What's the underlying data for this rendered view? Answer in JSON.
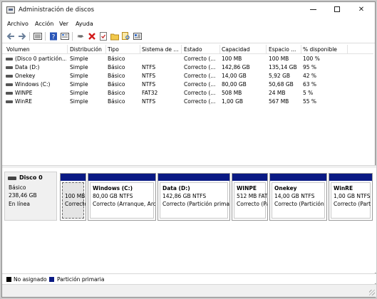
{
  "window": {
    "title": "Administración de discos"
  },
  "menu": [
    "Archivo",
    "Acción",
    "Ver",
    "Ayuda"
  ],
  "toolbar": {
    "icons": [
      "back-icon",
      "forward-icon",
      "list-view-icon",
      "help-icon",
      "properties-icon",
      "connect-icon",
      "delete-icon",
      "check-icon",
      "folder-icon",
      "search-icon",
      "settings-icon"
    ]
  },
  "columns": [
    "Volumen",
    "Distribución",
    "Tipo",
    "Sistema de ...",
    "Estado",
    "Capacidad",
    "Espacio ...",
    "% disponible"
  ],
  "volumes": [
    [
      "(Disco 0 partición...",
      "Simple",
      "Básico",
      "",
      "Correcto (...",
      "100 MB",
      "100 MB",
      "100 %"
    ],
    [
      "Data (D:)",
      "Simple",
      "Básico",
      "NTFS",
      "Correcto (...",
      "142,86 GB",
      "135,14 GB",
      "95 %"
    ],
    [
      "Onekey",
      "Simple",
      "Básico",
      "NTFS",
      "Correcto (...",
      "14,00 GB",
      "5,92 GB",
      "42 %"
    ],
    [
      "Windows (C:)",
      "Simple",
      "Básico",
      "NTFS",
      "Correcto (...",
      "80,00 GB",
      "50,68 GB",
      "63 %"
    ],
    [
      "WINPE",
      "Simple",
      "Básico",
      "FAT32",
      "Correcto (...",
      "508 MB",
      "24 MB",
      "5 %"
    ],
    [
      "WinRE",
      "Simple",
      "Básico",
      "NTFS",
      "Correcto (...",
      "1,00 GB",
      "567 MB",
      "55 %"
    ]
  ],
  "disk": {
    "name": "Disco 0",
    "type": "Básico",
    "size": "238,46 GB",
    "status": "En línea",
    "partitions": [
      {
        "name": "",
        "size": "100 MB",
        "status": "Correcto"
      },
      {
        "name": "Windows  (C:)",
        "size": "80,00 GB NTFS",
        "status": "Correcto (Arranque, Arc"
      },
      {
        "name": "Data  (D:)",
        "size": "142,86 GB NTFS",
        "status": "Correcto (Partición prima"
      },
      {
        "name": "WINPE",
        "size": "512 MB FAT",
        "status": "Correcto (Pa"
      },
      {
        "name": "Onekey",
        "size": "14,00 GB NTFS",
        "status": "Correcto (Partición"
      },
      {
        "name": "WinRE",
        "size": "1,00 GB NTFS",
        "status": "Correcto (Part"
      }
    ]
  },
  "legend": [
    {
      "label": "No asignado",
      "color": "#000000"
    },
    {
      "label": "Partición primaria",
      "color": "#0a1a84"
    }
  ]
}
